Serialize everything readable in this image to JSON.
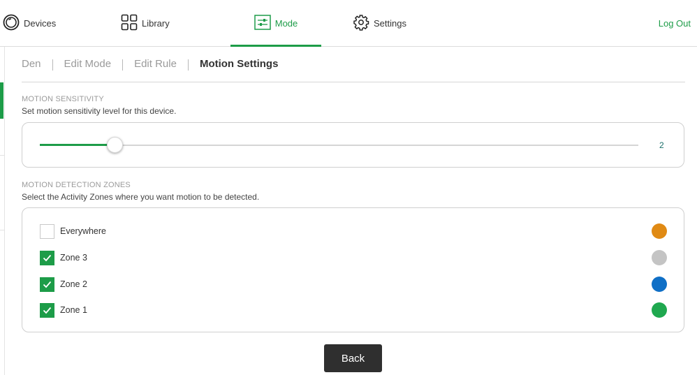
{
  "nav": {
    "devices": "Devices",
    "library": "Library",
    "mode": "Mode",
    "settings": "Settings",
    "logout": "Log Out"
  },
  "breadcrumb": [
    "Den",
    "Edit Mode",
    "Edit Rule",
    "Motion Settings"
  ],
  "sensitivity": {
    "title": "MOTION SENSITIVITY",
    "description": "Set motion sensitivity level for this device.",
    "value": "2",
    "level_fraction": 0.125
  },
  "zones": {
    "title": "MOTION DETECTION ZONES",
    "description": "Select the Activity Zones where you want motion to be detected.",
    "items": [
      {
        "label": "Everywhere",
        "checked": false,
        "color": "#e08a14"
      },
      {
        "label": "Zone 3",
        "checked": true,
        "color": "#c4c4c4"
      },
      {
        "label": "Zone 2",
        "checked": true,
        "color": "#0f6fc6"
      },
      {
        "label": "Zone 1",
        "checked": true,
        "color": "#1fa84f"
      }
    ]
  },
  "back_label": "Back",
  "colors": {
    "accent": "#1d9c48",
    "button": "#2f2f2f"
  }
}
